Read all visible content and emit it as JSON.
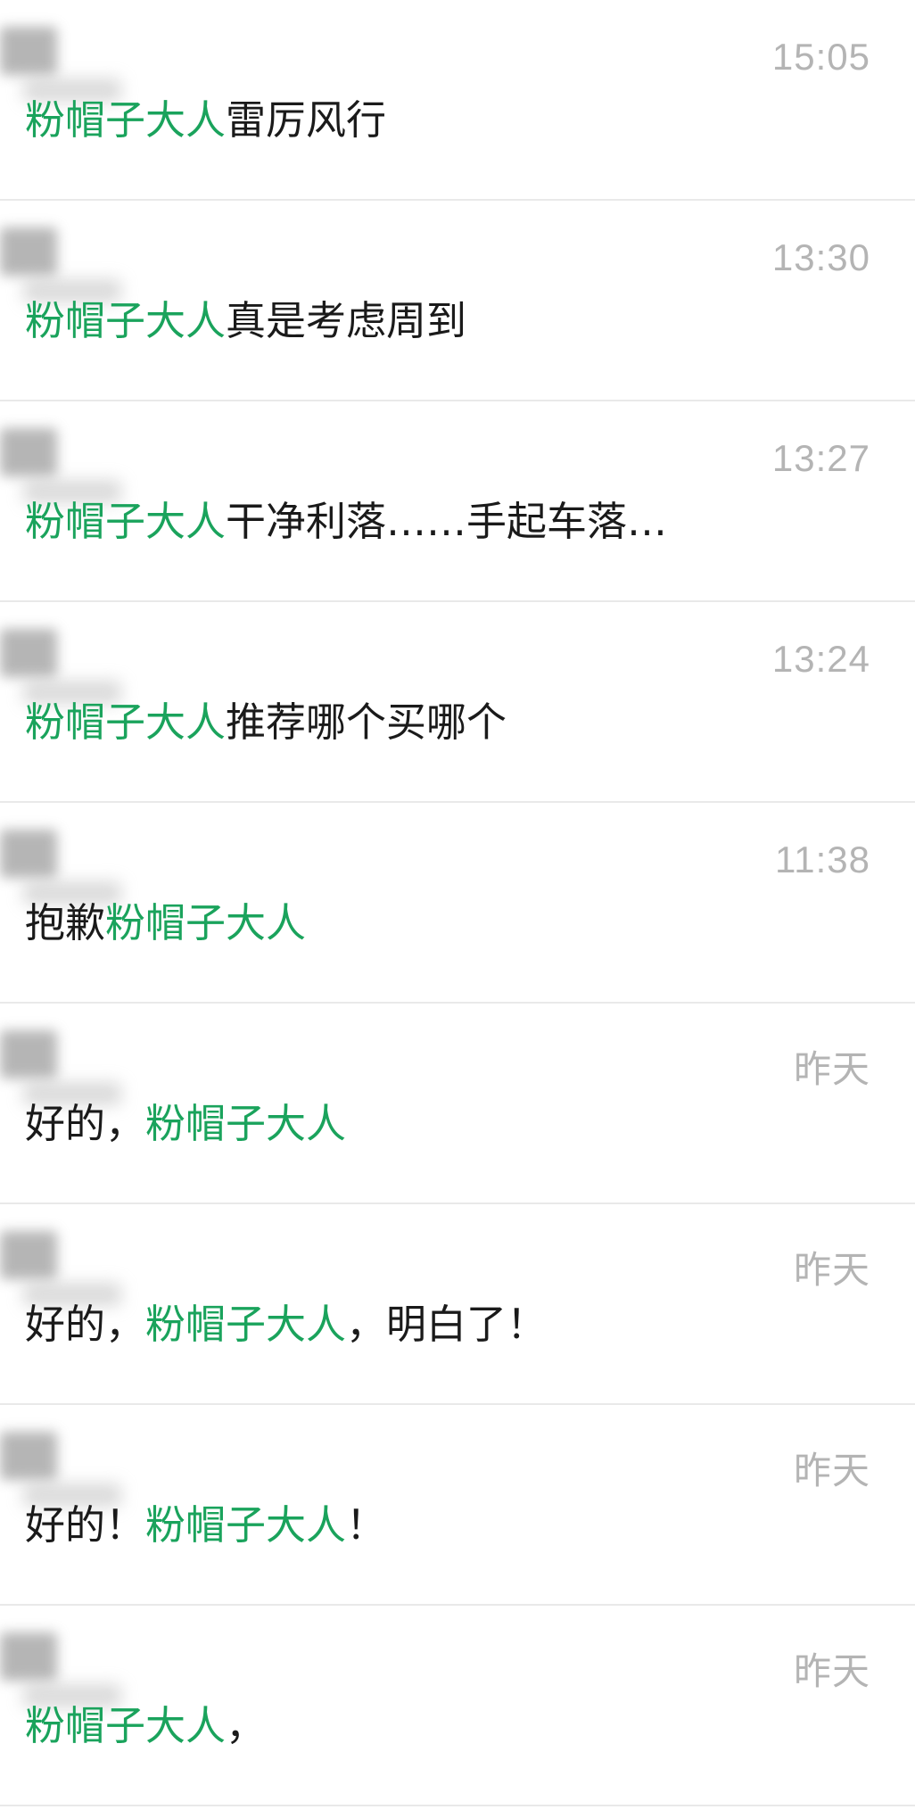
{
  "colors": {
    "mention_green": "#1aa35c",
    "text_dark": "#1a1a1a",
    "time_gray": "#b4b4b4",
    "divider": "#e9e9e9"
  },
  "messages": [
    {
      "time": "15:05",
      "segments": [
        {
          "text": "粉帽子大人",
          "green": true
        },
        {
          "text": "雷厉风行",
          "green": false
        }
      ]
    },
    {
      "time": "13:30",
      "segments": [
        {
          "text": "粉帽子大人",
          "green": true
        },
        {
          "text": "真是考虑周到",
          "green": false
        }
      ]
    },
    {
      "time": "13:27",
      "segments": [
        {
          "text": " 粉帽子大人",
          "green": true
        },
        {
          "text": "干净利落……手起车落…",
          "green": false
        }
      ]
    },
    {
      "time": "13:24",
      "segments": [
        {
          "text": "粉帽子大人",
          "green": true
        },
        {
          "text": "推荐哪个买哪个",
          "green": false
        }
      ]
    },
    {
      "time": "11:38",
      "segments": [
        {
          "text": "抱歉",
          "green": false
        },
        {
          "text": "粉帽子大人",
          "green": true
        }
      ]
    },
    {
      "time": "昨天",
      "segments": [
        {
          "text": "好的，",
          "green": false
        },
        {
          "text": "粉帽子大人",
          "green": true
        }
      ]
    },
    {
      "time": "昨天",
      "segments": [
        {
          "text": " 好的，",
          "green": false
        },
        {
          "text": "粉帽子大人",
          "green": true
        },
        {
          "text": "，明白了！",
          "green": false
        }
      ]
    },
    {
      "time": "昨天",
      "segments": [
        {
          "text": "好的！",
          "green": false
        },
        {
          "text": "粉帽子大人",
          "green": true
        },
        {
          "text": "！",
          "green": false
        }
      ]
    },
    {
      "time": "昨天",
      "segments": [
        {
          "text": "粉帽子大人",
          "green": true
        },
        {
          "text": "，",
          "green": false
        }
      ]
    }
  ]
}
